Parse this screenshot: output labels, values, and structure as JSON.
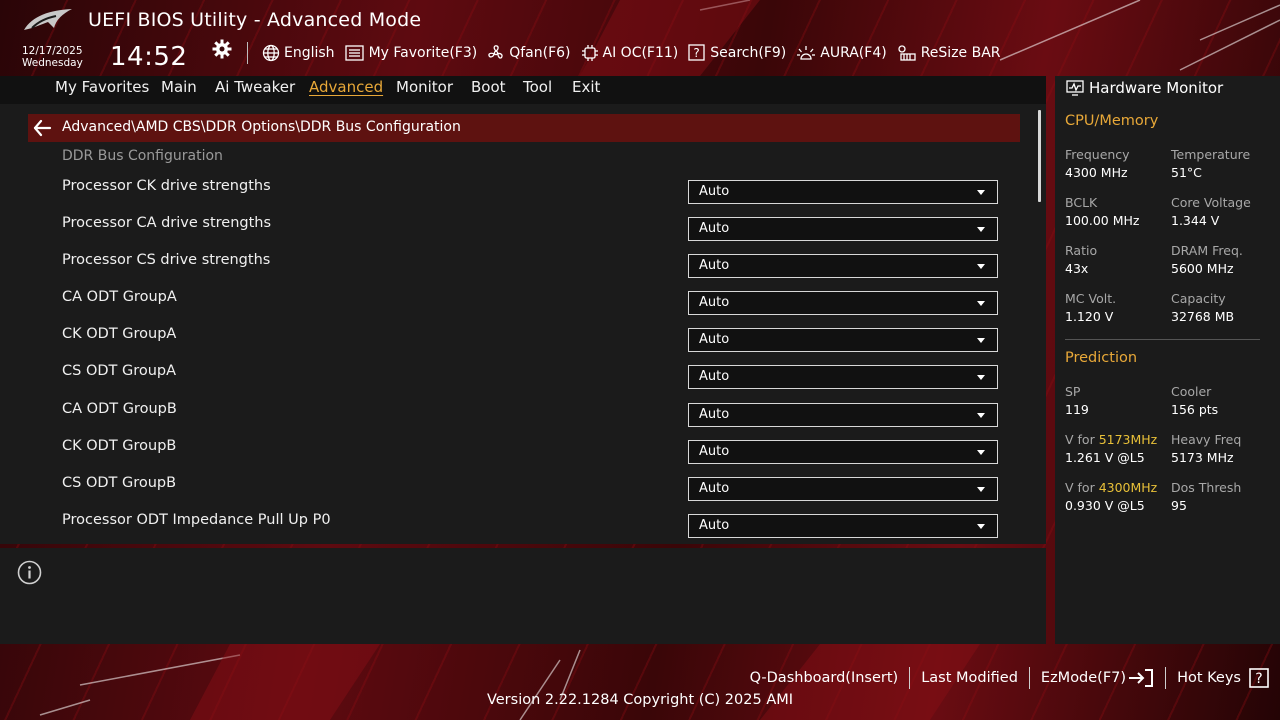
{
  "window": {
    "title": "UEFI BIOS Utility - Advanced Mode"
  },
  "datetime": {
    "date": "12/17/2025",
    "weekday": "Wednesday",
    "time": "14:52"
  },
  "toolbar": {
    "items": [
      {
        "label": "English",
        "icon": "globe-icon"
      },
      {
        "label": "My Favorite(F3)",
        "icon": "favorite-list-icon"
      },
      {
        "label": "Qfan(F6)",
        "icon": "fan-icon"
      },
      {
        "label": "AI OC(F11)",
        "icon": "ai-chip-icon"
      },
      {
        "label": "Search(F9)",
        "icon": "search-icon"
      },
      {
        "label": "AURA(F4)",
        "icon": "aura-light-icon"
      },
      {
        "label": "ReSize BAR",
        "icon": "resize-bar-icon"
      }
    ]
  },
  "nav": {
    "tabs": [
      {
        "label": "My Favorites"
      },
      {
        "label": "Main"
      },
      {
        "label": "Ai Tweaker"
      },
      {
        "label": "Advanced",
        "active": true
      },
      {
        "label": "Monitor"
      },
      {
        "label": "Boot"
      },
      {
        "label": "Tool"
      },
      {
        "label": "Exit"
      }
    ]
  },
  "main": {
    "path": "Advanced\\AMD CBS\\DDR Options\\DDR Bus Configuration",
    "section_title": "DDR Bus Configuration",
    "rows": [
      {
        "label": "Processor CK drive strengths",
        "value": "Auto"
      },
      {
        "label": "Processor CA drive strengths",
        "value": "Auto"
      },
      {
        "label": "Processor CS drive strengths",
        "value": "Auto"
      },
      {
        "label": "CA ODT GroupA",
        "value": "Auto"
      },
      {
        "label": "CK ODT GroupA",
        "value": "Auto"
      },
      {
        "label": "CS ODT GroupA",
        "value": "Auto"
      },
      {
        "label": "CA ODT GroupB",
        "value": "Auto"
      },
      {
        "label": "CK ODT GroupB",
        "value": "Auto"
      },
      {
        "label": "CS ODT GroupB",
        "value": "Auto"
      },
      {
        "label": "Processor ODT Impedance Pull Up P0",
        "value": "Auto"
      }
    ]
  },
  "hw_monitor": {
    "title": "Hardware Monitor",
    "cpu_memory": {
      "title": "CPU/Memory",
      "frequency": {
        "label": "Frequency",
        "value": "4300 MHz"
      },
      "temperature": {
        "label": "Temperature",
        "value": "51°C"
      },
      "bclk": {
        "label": "BCLK",
        "value": "100.00 MHz"
      },
      "core_voltage": {
        "label": "Core Voltage",
        "value": "1.344 V"
      },
      "ratio": {
        "label": "Ratio",
        "value": "43x"
      },
      "dram_freq": {
        "label": "DRAM Freq.",
        "value": "5600 MHz"
      },
      "mc_volt": {
        "label": "MC Volt.",
        "value": "1.120 V"
      },
      "capacity": {
        "label": "Capacity",
        "value": "32768 MB"
      }
    },
    "prediction": {
      "title": "Prediction",
      "sp": {
        "label": "SP",
        "value": "119"
      },
      "cooler": {
        "label": "Cooler",
        "value": "156 pts"
      },
      "v_for_1": {
        "prefix": "V for ",
        "freq": "5173MHz",
        "value": "1.261 V @L5"
      },
      "heavy_freq": {
        "label": "Heavy Freq",
        "value": "5173 MHz"
      },
      "v_for_2": {
        "prefix": "V for ",
        "freq": "4300MHz",
        "value": "0.930 V @L5"
      },
      "dos_thresh": {
        "label": "Dos Thresh",
        "value": "95"
      }
    }
  },
  "footer": {
    "links": {
      "q_dashboard": "Q-Dashboard(Insert)",
      "last_modified": "Last Modified",
      "ezmode": "EzMode(F7)",
      "hot_keys": "Hot Keys"
    },
    "version": "Version 2.22.1284 Copyright (C) 2025 AMI"
  },
  "colors": {
    "accent": "#e8a838",
    "highlight": "#e8c038",
    "path_bar": "#5e1210",
    "panel": "#1b1b1b"
  }
}
